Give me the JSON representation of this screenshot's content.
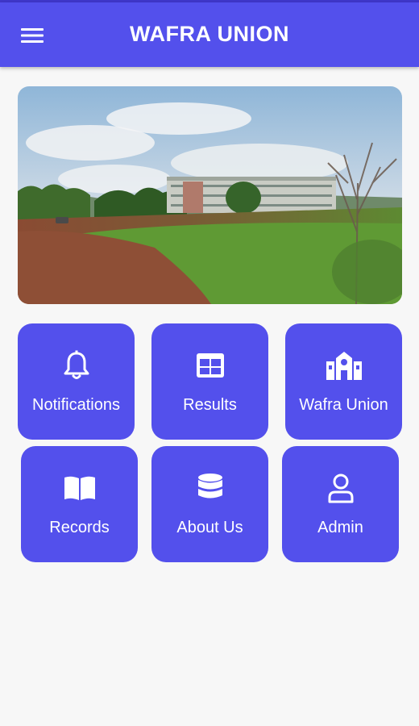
{
  "app": {
    "title": "WAFRA UNION",
    "accent_color": "#5350ec"
  },
  "appbar": {
    "menu_icon": "hamburger-menu-icon"
  },
  "hero": {
    "image": "campus-building-photo"
  },
  "tiles": [
    {
      "label": "Notifications",
      "icon": "bell-icon"
    },
    {
      "label": "Results",
      "icon": "table-grid-icon"
    },
    {
      "label": "Wafra Union",
      "icon": "school-building-icon"
    },
    {
      "label": "Records",
      "icon": "open-book-icon"
    },
    {
      "label": "About Us",
      "icon": "database-icon"
    },
    {
      "label": "Admin",
      "icon": "user-icon"
    }
  ]
}
